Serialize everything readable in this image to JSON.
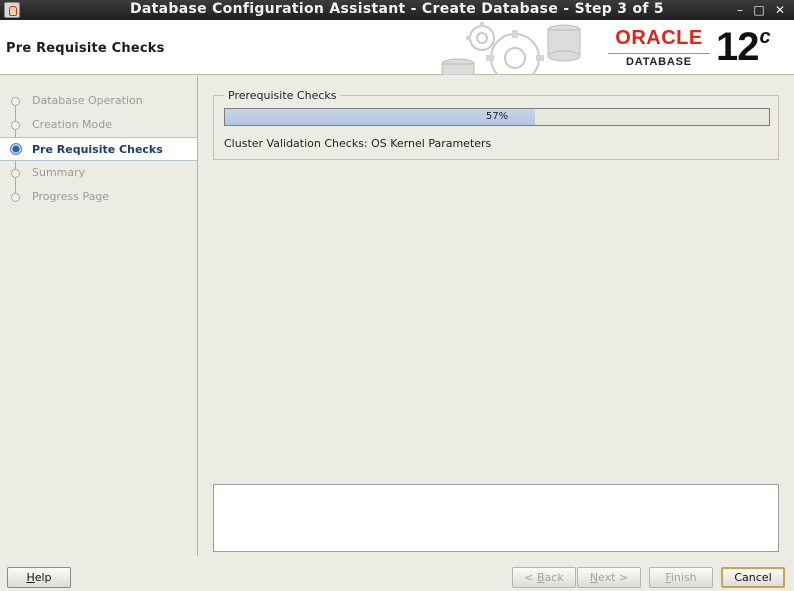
{
  "window": {
    "title": "Database Configuration Assistant - Create Database - Step 3 of 5",
    "controls": {
      "minimize": "–",
      "maximize": "□",
      "close": "✕"
    }
  },
  "header": {
    "page_title": "Pre Requisite Checks",
    "logo": {
      "brand": "ORACLE",
      "product": "DATABASE",
      "version": "12",
      "version_suffix": "c"
    }
  },
  "sidebar": {
    "steps": [
      {
        "label": "Database Operation",
        "state": "done"
      },
      {
        "label": "Creation Mode",
        "state": "done"
      },
      {
        "label": "Pre Requisite Checks",
        "state": "active"
      },
      {
        "label": "Summary",
        "state": "pending"
      },
      {
        "label": "Progress Page",
        "state": "pending"
      }
    ]
  },
  "prereq": {
    "legend": "Prerequisite Checks",
    "progress_percent": 57,
    "progress_label": "57%",
    "status_text": "Cluster Validation Checks: OS Kernel Parameters"
  },
  "buttons": {
    "help": {
      "label": "Help",
      "mnemonic": "H",
      "rest": "elp"
    },
    "back": {
      "label": "< Back",
      "pre": "< ",
      "mnemonic": "B",
      "rest": "ack"
    },
    "next": {
      "label": "Next >",
      "mnemonic": "N",
      "rest": "ext >"
    },
    "finish": {
      "label": "Finish",
      "mnemonic": "F",
      "rest": "inish"
    },
    "cancel": {
      "label": "Cancel"
    }
  },
  "colors": {
    "oracle_red": "#e2231a",
    "active_step": "#1b3c6c",
    "progress_fill": "#b8cbe4"
  }
}
